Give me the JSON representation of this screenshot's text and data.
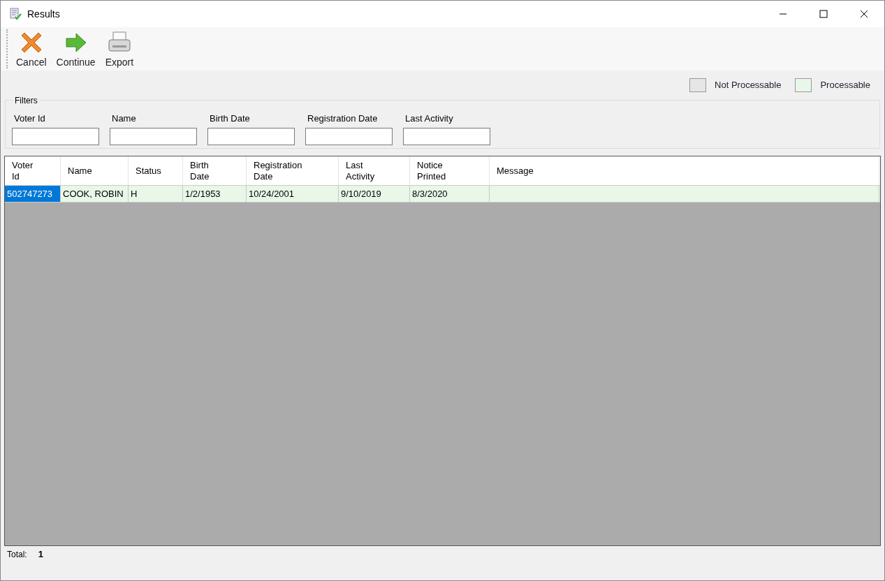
{
  "window": {
    "title": "Results"
  },
  "toolbar": [
    {
      "kind": "cancel",
      "label": "Cancel"
    },
    {
      "kind": "continue",
      "label": "Continue"
    },
    {
      "kind": "export",
      "label": "Export"
    }
  ],
  "legend": [
    {
      "label": "Not Processable",
      "color": "#e6e6e6"
    },
    {
      "label": "Processable",
      "color": "#e8f7e8"
    }
  ],
  "filters": {
    "title": "Filters",
    "fields": [
      {
        "label": "Voter Id"
      },
      {
        "label": "Name"
      },
      {
        "label": "Birth Date"
      },
      {
        "label": "Registration Date"
      },
      {
        "label": "Last Activity"
      }
    ]
  },
  "table": {
    "columns": [
      "Voter\nId",
      "Name",
      "Status",
      "Birth\nDate",
      "Registration\nDate",
      "Last\nActivity",
      "Notice\nPrinted",
      "Message"
    ],
    "rows": [
      {
        "processable": true,
        "selected": true,
        "cells": [
          "502747273",
          "COOK, ROBIN",
          "H",
          "1/2/1953",
          "10/24/2001",
          "9/10/2019",
          "8/3/2020",
          ""
        ]
      }
    ]
  },
  "status_bar": {
    "label": "Total:",
    "value": "1"
  }
}
